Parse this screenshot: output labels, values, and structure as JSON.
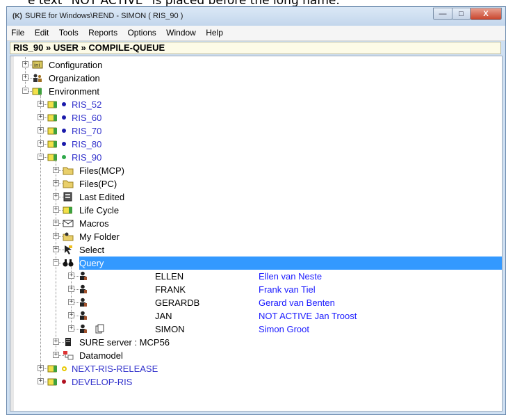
{
  "caption": "e text \"NOT ACTIVE\" is placed before the long name.",
  "window": {
    "title": "SURE for Windows\\REND - SIMON ( RIS_90 )",
    "app_icon": "(K)",
    "minimize_glyph": "—",
    "maximize_glyph": "□",
    "close_glyph": "X"
  },
  "menu": [
    "File",
    "Edit",
    "Tools",
    "Reports",
    "Options",
    "Window",
    "Help"
  ],
  "path": "RIS_90 » USER » COMPILE-QUEUE",
  "tree": [
    {
      "label": "Configuration",
      "icon": "config-icon",
      "level": 0,
      "expander": "+"
    },
    {
      "label": "Organization",
      "icon": "organization-icon",
      "level": 0,
      "expander": "+"
    },
    {
      "label": "Environment",
      "icon": "environment-icon",
      "level": 0,
      "expander": "−"
    },
    {
      "label": "RIS_52",
      "icon": "environment-icon",
      "level": 1,
      "expander": "+",
      "dot": "#1a1aaa",
      "style": "env"
    },
    {
      "label": "RIS_60",
      "icon": "environment-icon",
      "level": 1,
      "expander": "+",
      "dot": "#1a1aaa",
      "style": "env"
    },
    {
      "label": "RIS_70",
      "icon": "environment-icon",
      "level": 1,
      "expander": "+",
      "dot": "#1a1aaa",
      "style": "env"
    },
    {
      "label": "RIS_80",
      "icon": "environment-icon",
      "level": 1,
      "expander": "+",
      "dot": "#1a1aaa",
      "style": "env"
    },
    {
      "label": "RIS_90",
      "icon": "environment-icon",
      "level": 1,
      "expander": "−",
      "dot": "#2ea84a",
      "style": "env"
    },
    {
      "label": "Files(MCP)",
      "icon": "folder-icon",
      "level": 2,
      "expander": "+"
    },
    {
      "label": "Files(PC)",
      "icon": "folder-icon",
      "level": 2,
      "expander": "+"
    },
    {
      "label": "Last Edited",
      "icon": "document-icon",
      "level": 2,
      "expander": "+"
    },
    {
      "label": "Life Cycle",
      "icon": "lifecycle-icon",
      "level": 2,
      "expander": "+"
    },
    {
      "label": "Macros",
      "icon": "macro-icon",
      "level": 2,
      "expander": "+"
    },
    {
      "label": "My Folder",
      "icon": "my-folder-icon",
      "level": 2,
      "expander": "+"
    },
    {
      "label": "Select",
      "icon": "select-icon",
      "level": 2,
      "expander": "+"
    },
    {
      "label": "Query",
      "icon": "binoculars-icon",
      "level": 2,
      "expander": "−",
      "selected": true
    },
    {
      "label": "ELLEN",
      "long": "Ellen van Neste",
      "icon": "user-icon",
      "level": 3,
      "expander": "+"
    },
    {
      "label": "FRANK",
      "long": "Frank van Tiel",
      "icon": "user-icon",
      "level": 3,
      "expander": "+"
    },
    {
      "label": "GERARDB",
      "long": "Gerard van Benten",
      "icon": "user-icon",
      "level": 3,
      "expander": "+"
    },
    {
      "label": "JAN",
      "long": "NOT ACTIVE  Jan Troost",
      "icon": "user-icon",
      "level": 3,
      "expander": "+"
    },
    {
      "label": "SIMON",
      "long": "Simon Groot",
      "icon": "user-icon",
      "level": 3,
      "expander": "+",
      "extra_icon": "copy-icon"
    },
    {
      "label": "SURE server : MCP56",
      "icon": "server-icon",
      "level": 2,
      "expander": "+"
    },
    {
      "label": "Datamodel",
      "icon": "datamodel-icon",
      "level": 2,
      "expander": "+"
    },
    {
      "label": "NEXT-RIS-RELEASE",
      "icon": "environment-icon",
      "level": 1,
      "expander": "+",
      "dot": "#e8c800",
      "ring": true,
      "style": "env"
    },
    {
      "label": "DEVELOP-RIS",
      "icon": "environment-icon",
      "level": 1,
      "expander": "+",
      "dot": "#b01020",
      "style": "env"
    }
  ]
}
